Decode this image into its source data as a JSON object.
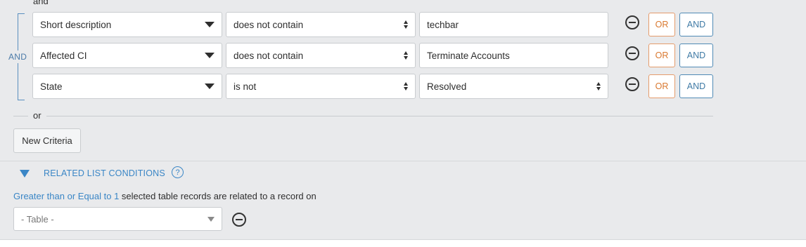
{
  "top_group_label": "and",
  "bracket_label": "AND",
  "conditions": [
    {
      "field": "Short description",
      "operator": "does not contain",
      "value": "techbar",
      "value_type": "text",
      "or_label": "OR",
      "and_label": "AND"
    },
    {
      "field": "Affected CI",
      "operator": "does not contain",
      "value": "Terminate Accounts",
      "value_type": "text",
      "or_label": "OR",
      "and_label": "AND"
    },
    {
      "field": "State",
      "operator": "is not",
      "value": "Resolved",
      "value_type": "select",
      "or_label": "OR",
      "and_label": "AND"
    }
  ],
  "or_separator": "or",
  "new_criteria_label": "New Criteria",
  "related": {
    "title": "RELATED LIST CONDITIONS",
    "help_icon": "?",
    "quantity_link": "Greater than or Equal to 1",
    "description": " selected table records are related to a record on",
    "table_placeholder": "- Table -"
  },
  "colors": {
    "or_accent": "#d9782f",
    "and_accent": "#3f7aa5",
    "link": "#3a86c6",
    "background": "#e9eaec"
  }
}
